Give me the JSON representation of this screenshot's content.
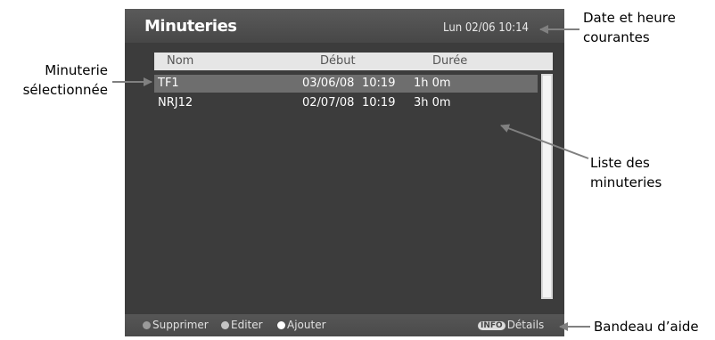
{
  "screen": {
    "title": "Minuteries",
    "datetime": "Lun 02/06 10:14",
    "columns": {
      "name": "Nom",
      "start": "Début",
      "duration": "Durée"
    },
    "timers": [
      {
        "name": "TF1",
        "date": "03/06/08",
        "time": "10:19",
        "duration": "1h 0m",
        "selected": true
      },
      {
        "name": "NRJ12",
        "date": "02/07/08",
        "time": "10:19",
        "duration": "3h 0m",
        "selected": false
      }
    ],
    "help": {
      "delete": "Supprimer",
      "edit": "Editer",
      "add": "Ajouter",
      "info_key": "INFO",
      "details": "Détails"
    },
    "colors": {
      "dot_delete": "#9a9a9a",
      "dot_edit": "#c4c4c4",
      "dot_add": "#ffffff"
    }
  },
  "annotations": {
    "selected_timer": [
      "Minuterie",
      "sélectionnée"
    ],
    "date_time": [
      "Date et heure",
      "courantes"
    ],
    "timer_list": [
      "Liste des",
      "minuteries"
    ],
    "help_bar": "Bandeau d’aide"
  }
}
